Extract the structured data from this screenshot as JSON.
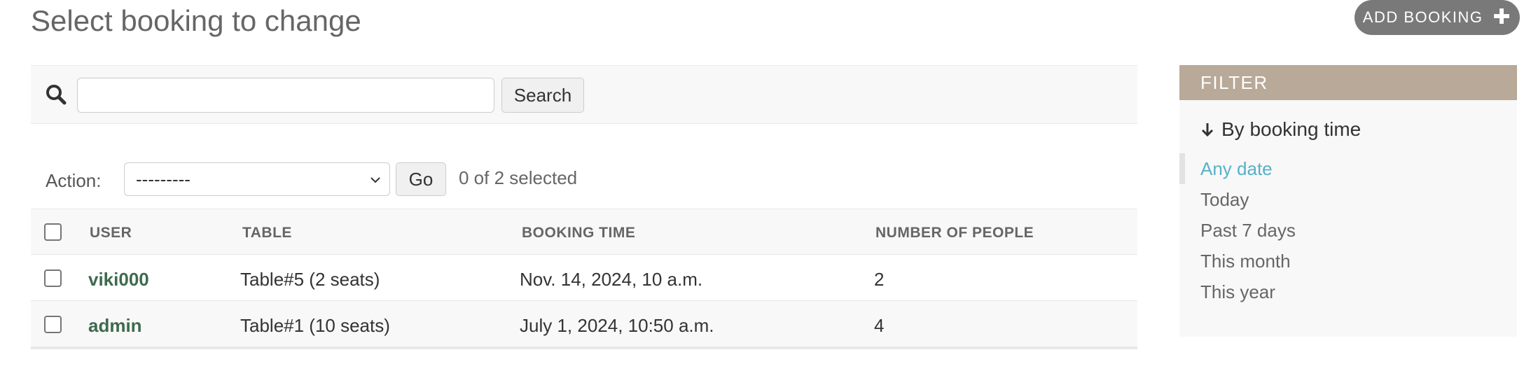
{
  "page": {
    "title": "Select booking to change",
    "add_button_label": "ADD BOOKING"
  },
  "search": {
    "value": "",
    "button_label": "Search"
  },
  "actions": {
    "label": "Action:",
    "selected_option": "---------",
    "go_label": "Go",
    "selected_count_text": "0 of 2 selected"
  },
  "table": {
    "columns": [
      "USER",
      "TABLE",
      "BOOKING TIME",
      "NUMBER OF PEOPLE"
    ],
    "rows": [
      {
        "user": "viki000",
        "table": "Table#5 (2 seats)",
        "booking_time": "Nov. 14, 2024, 10 a.m.",
        "people": "2"
      },
      {
        "user": "admin",
        "table": "Table#1 (10 seats)",
        "booking_time": "July 1, 2024, 10:50 a.m.",
        "people": "4"
      }
    ]
  },
  "filter": {
    "header": "FILTER",
    "title": "By booking time",
    "options": [
      {
        "label": "Any date",
        "selected": true
      },
      {
        "label": "Today",
        "selected": false
      },
      {
        "label": "Past 7 days",
        "selected": false
      },
      {
        "label": "This month",
        "selected": false
      },
      {
        "label": "This year",
        "selected": false
      }
    ]
  },
  "colors": {
    "link": "#3e6a4e",
    "filter_header_bg": "#b8a998",
    "filter_selected": "#59b1c6",
    "add_button_bg": "#797979"
  }
}
